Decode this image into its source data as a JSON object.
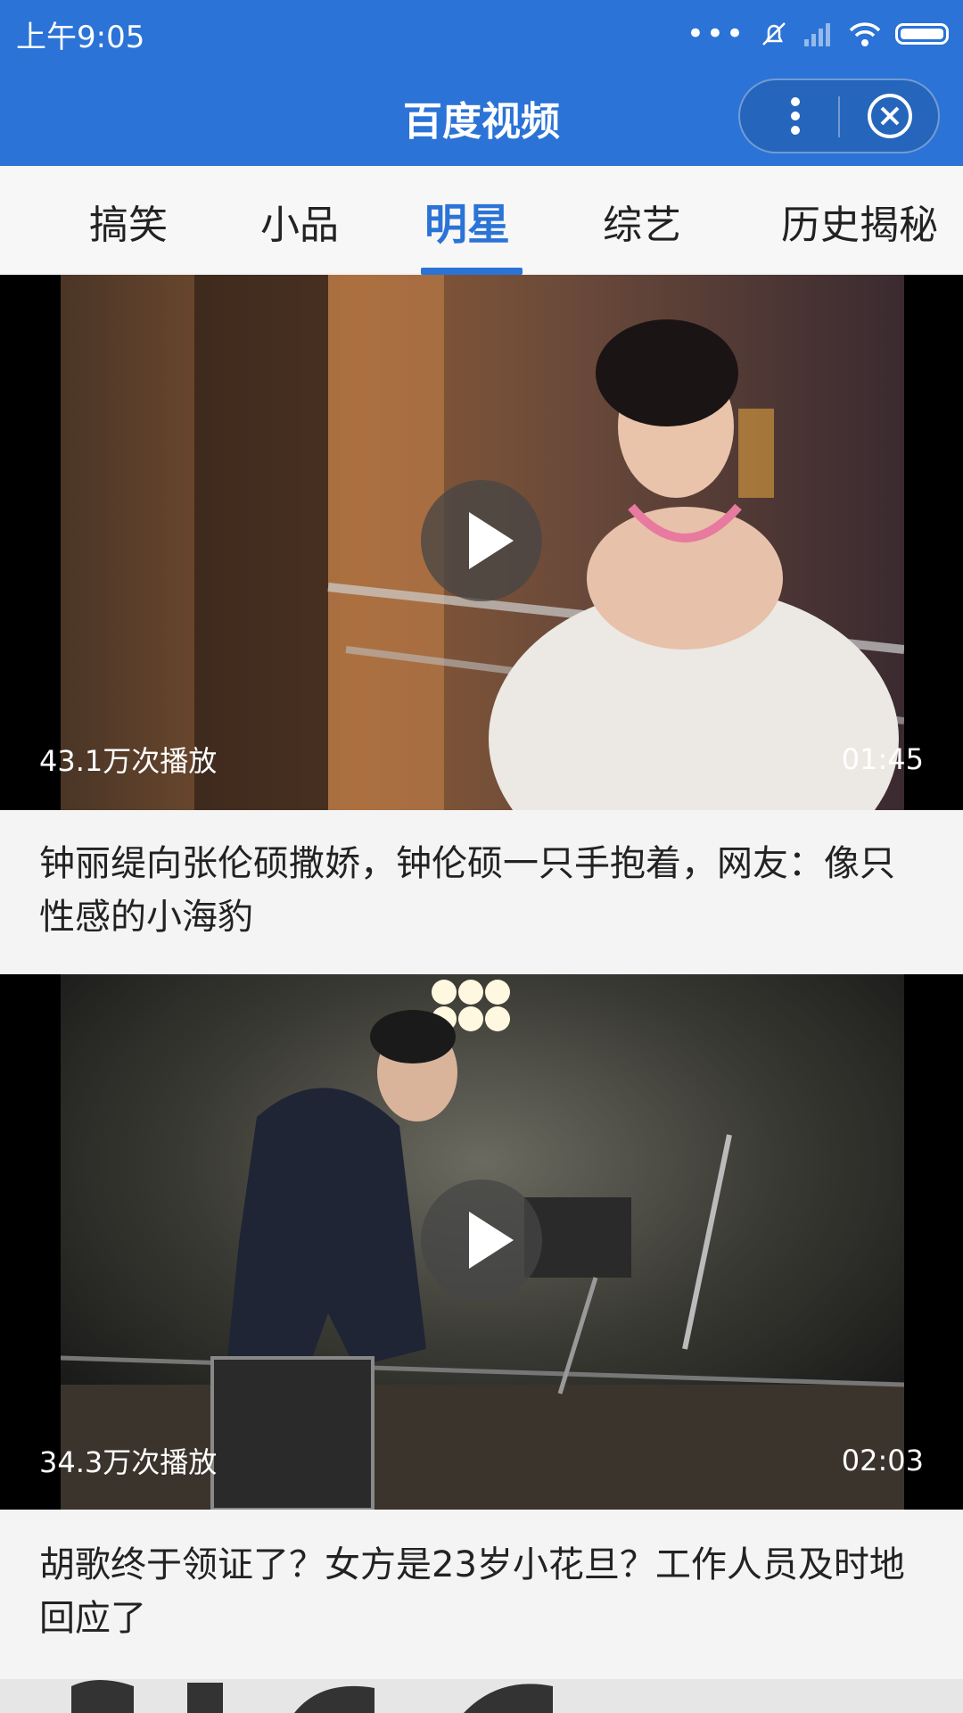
{
  "status_bar": {
    "time": "上午9:05"
  },
  "header": {
    "title": "百度视频"
  },
  "tabs": [
    {
      "label": "搞笑",
      "active": false
    },
    {
      "label": "小品",
      "active": false
    },
    {
      "label": "明星",
      "active": true
    },
    {
      "label": "综艺",
      "active": false
    },
    {
      "label": "历史揭秘",
      "active": false
    }
  ],
  "videos": [
    {
      "views": "43.1万次播放",
      "duration": "01:45",
      "title": "钟丽缇向张伦硕撒娇，钟伦硕一只手抱着，网友：像只性感的小海豹"
    },
    {
      "views": "34.3万次播放",
      "duration": "02:03",
      "title": "胡歌终于领证了？女方是23岁小花旦？工作人员及时地回应了"
    }
  ],
  "colors": {
    "accent": "#2b73d6"
  }
}
